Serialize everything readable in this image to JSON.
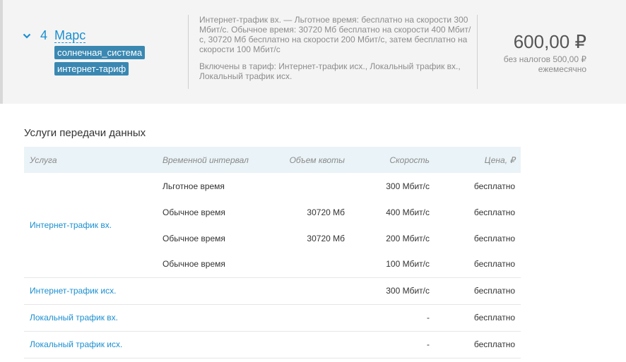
{
  "tariff": {
    "count": "4",
    "name": "Марс",
    "tags": [
      "солнечная_система",
      "интернет-тариф"
    ],
    "description": "Интернет-трафик вх. — Льготное время: бесплатно на скорости 300 Мбит/с. Обычное время: 30720 Мб бесплатно на скорости 400 Мбит/с, 30720 Мб бесплатно на скорости 200 Мбит/с, затем бесплатно на скорости 100 Мбит/с",
    "included": "Включены в тариф: Интернет-трафик исх., Локальный трафик вх., Локальный трафик исх.",
    "price": "600,00 ₽",
    "price_no_tax": "без налогов 500,00 ₽",
    "period": "ежемесячно"
  },
  "services": {
    "title": "Услуги передачи данных",
    "columns": [
      "Услуга",
      "Временной интервал",
      "Объем квоты",
      "Скорость",
      "Цена, ₽"
    ],
    "rows": [
      {
        "service": "Интернет-трафик вх.",
        "interval": "Льготное время",
        "quota": "",
        "speed": "300 Мбит/с",
        "price": "бесплатно"
      },
      {
        "service": "",
        "interval": "Обычное время",
        "quota": "30720 Мб",
        "speed": "400 Мбит/с",
        "price": "бесплатно"
      },
      {
        "service": "",
        "interval": "Обычное время",
        "quota": "30720 Мб",
        "speed": "200 Мбит/с",
        "price": "бесплатно"
      },
      {
        "service": "",
        "interval": "Обычное время",
        "quota": "",
        "speed": "100 Мбит/с",
        "price": "бесплатно"
      },
      {
        "service": "Интернет-трафик исх.",
        "interval": "",
        "quota": "",
        "speed": "300 Мбит/с",
        "price": "бесплатно"
      },
      {
        "service": "Локальный трафик вх.",
        "interval": "",
        "quota": "",
        "speed": "-",
        "price": "бесплатно"
      },
      {
        "service": "Локальный трафик исх.",
        "interval": "",
        "quota": "",
        "speed": "-",
        "price": "бесплатно"
      }
    ]
  },
  "icons": {
    "expand": "chevron-down-icon"
  },
  "colors": {
    "link": "#1a8fd0",
    "tag_bg": "#3a88b2",
    "header_bg": "#eaf3f7",
    "panel_bg": "#f4f4f4"
  }
}
